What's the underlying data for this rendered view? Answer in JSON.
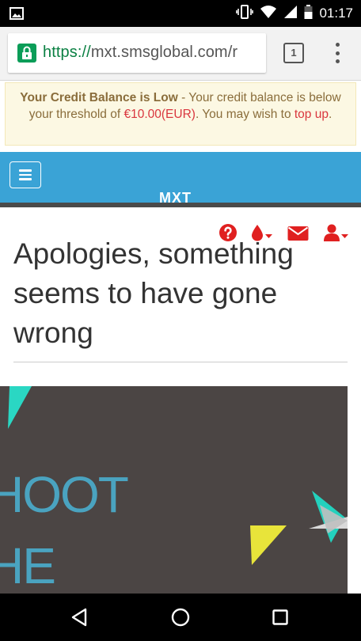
{
  "status_bar": {
    "time": "01:17"
  },
  "browser": {
    "url_scheme": "https://",
    "url_rest": "mxt.smsglobal.com/r",
    "tab_count": "1"
  },
  "alert": {
    "title": "Your Credit Balance is Low",
    "text_before": " - Your credit balance is below your threshold of ",
    "amount": "€10.00(EUR)",
    "text_after": ". You may wish to ",
    "link": "top up",
    "end": "."
  },
  "header": {
    "logo": "MXT"
  },
  "page": {
    "heading": "Apologies, something seems to have gone wrong"
  },
  "art": {
    "line1": "HOOT",
    "line2": "HE"
  },
  "colors": {
    "brand_blue": "#3aa3d6",
    "accent_red": "#e02020",
    "alert_bg": "#fcf8e3"
  },
  "icons": [
    "help-icon",
    "credit-drop-icon",
    "mail-icon",
    "user-icon"
  ]
}
